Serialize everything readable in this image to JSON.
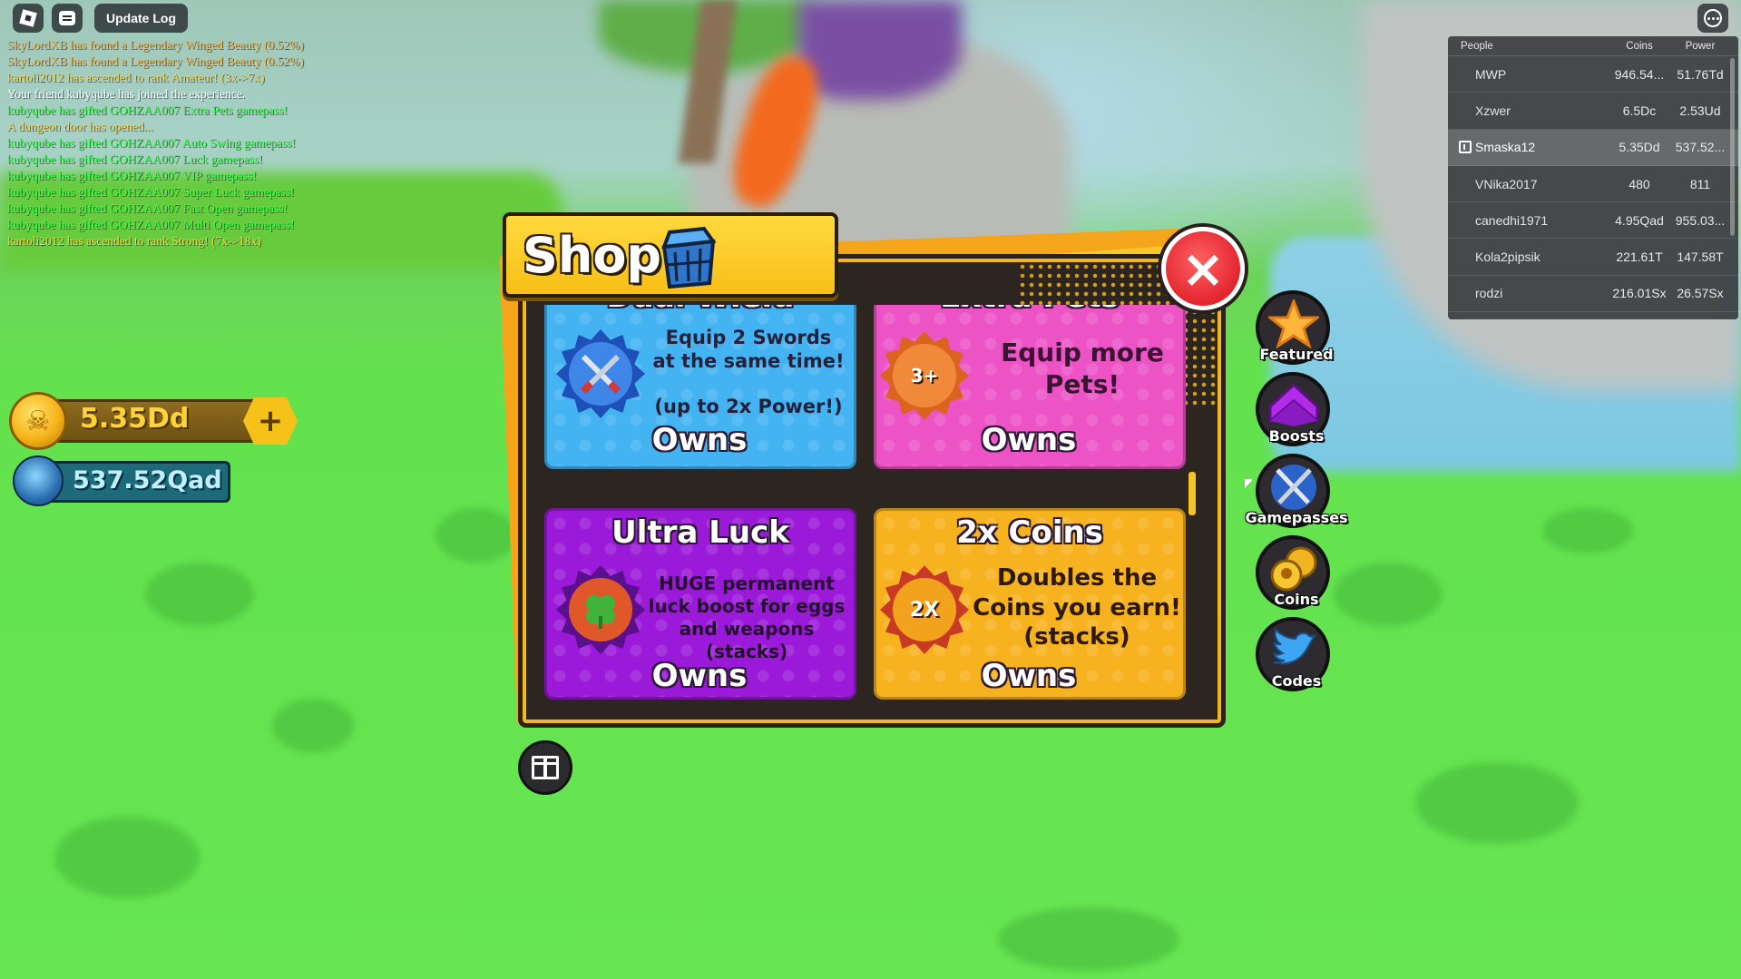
{
  "top_bar": {
    "update_log_label": "Update Log"
  },
  "chat": [
    {
      "text": "SkyLordXB has found a Legendary Winged Beauty (0.52%)",
      "color": "#f5b34a"
    },
    {
      "text": "SkyLordXB has found a Legendary Winged Beauty (0.52%)",
      "color": "#f5b34a"
    },
    {
      "text": "kartoli2012 has ascended to rank Amateur! (3x->7x)",
      "color": "#f7d44a"
    },
    {
      "text": "Your friend kubyqube has joined the experience.",
      "color": "#ffffff"
    },
    {
      "text": "kubyqube has gifted GOHZAA007 Extra Pets gamepass!",
      "color": "#39ff4d"
    },
    {
      "text": "A dungeon door has opened...",
      "color": "#f7d44a"
    },
    {
      "text": "kubyqube has gifted GOHZAA007 Auto Swing gamepass!",
      "color": "#39ff4d"
    },
    {
      "text": "kubyqube has gifted GOHZAA007 Luck gamepass!",
      "color": "#39ff4d"
    },
    {
      "text": "kubyqube has gifted GOHZAA007 VIP gamepass!",
      "color": "#39ff4d"
    },
    {
      "text": "kubyqube has gifted GOHZAA007 Super Luck gamepass!",
      "color": "#39ff4d"
    },
    {
      "text": "kubyqube has gifted GOHZAA007 Fast Open gamepass!",
      "color": "#39ff4d"
    },
    {
      "text": "kubyqube has gifted GOHZAA007 Multi Open gamepass!",
      "color": "#39ff4d"
    },
    {
      "text": "kartoli2012 has ascended to rank Strong! (7x->18x)",
      "color": "#f7d44a"
    }
  ],
  "currency": {
    "coins": "5.35Dd",
    "coins_plus": "+",
    "gems": "537.52Qad"
  },
  "leaderboard": {
    "headers": {
      "people": "People",
      "coins": "Coins",
      "power": "Power"
    },
    "rows": [
      {
        "name": "MWP",
        "coins": "946.54...",
        "power": "51.76Td",
        "me": false
      },
      {
        "name": "Xzwer",
        "coins": "6.5Dc",
        "power": "2.53Ud",
        "me": false
      },
      {
        "name": "Smaska12",
        "coins": "5.35Dd",
        "power": "537.52...",
        "me": true
      },
      {
        "name": "VNika2017",
        "coins": "480",
        "power": "811",
        "me": false
      },
      {
        "name": "canedhi1971",
        "coins": "4.95Qad",
        "power": "955.03...",
        "me": false
      },
      {
        "name": "Kola2pipsik",
        "coins": "221.61T",
        "power": "147.58T",
        "me": false
      },
      {
        "name": "rodzi",
        "coins": "216.01Sx",
        "power": "26.57Sx",
        "me": false
      }
    ]
  },
  "shop": {
    "title": "Shop",
    "close_label": "×",
    "cards": [
      {
        "title": "Dual Wield",
        "desc": "Equip 2 Swords at the same time!",
        "desc2": "(up to 2x Power!)",
        "status": "Owns",
        "badge_text": ""
      },
      {
        "title": "Extra Pets",
        "desc": "Equip more Pets!",
        "desc2": "",
        "status": "Owns",
        "badge_text": "3+"
      },
      {
        "title": "Ultra Luck",
        "desc": "HUGE permanent luck boost for eggs and weapons (stacks)",
        "desc2": "",
        "status": "Owns",
        "badge_text": ""
      },
      {
        "title": "2x Coins",
        "desc": "Doubles the Coins you earn! (stacks)",
        "desc2": "",
        "status": "Owns",
        "badge_text": "2X"
      }
    ]
  },
  "side_menu": [
    {
      "label": "Featured",
      "icon": "star-icon"
    },
    {
      "label": "Boosts",
      "icon": "chevron-up-icon"
    },
    {
      "label": "Gamepasses",
      "icon": "crossed-swords-icon"
    },
    {
      "label": "Coins",
      "icon": "skull-coins-icon"
    },
    {
      "label": "Codes",
      "icon": "bird-icon"
    }
  ],
  "colors": {
    "card_dual_wield": "#43b3f2",
    "card_extra_pets": "#ec54c6",
    "card_ultra_luck": "#9b19d8",
    "card_2x_coins": "#f7b21f",
    "shop_accent": "#f7c21d",
    "close_button": "#e7252f"
  }
}
